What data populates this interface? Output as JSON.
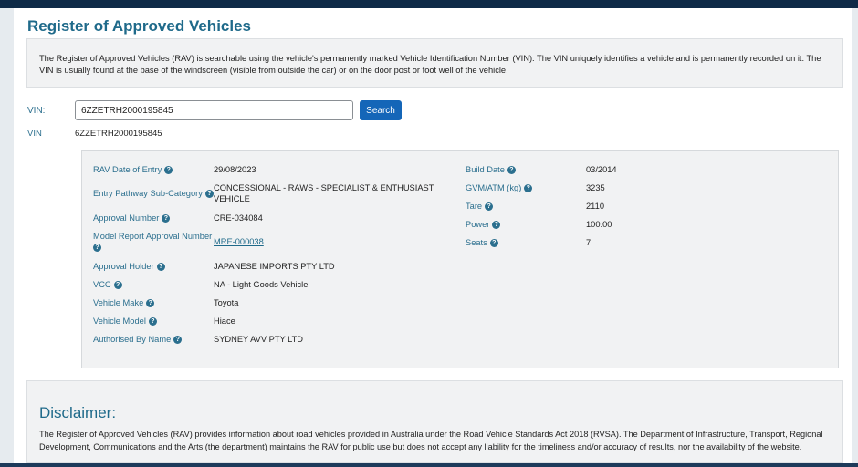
{
  "page": {
    "title": "Register of Approved Vehicles",
    "intro": "The Register of Approved Vehicles (RAV) is searchable using the vehicle's permanently marked Vehicle Identification Number (VIN). The VIN uniquely identifies a vehicle and is permanently recorded on it. The VIN is usually found at the base of the windscreen (visible from outside the car) or on the door post or foot well of the vehicle."
  },
  "search": {
    "label": "VIN:",
    "value": "6ZZETRH2000195845",
    "button_label": "Search"
  },
  "result": {
    "vin_label": "VIN",
    "vin_value": "6ZZETRH2000195845"
  },
  "details": {
    "left": [
      {
        "label": "RAV Date of Entry",
        "value": "29/08/2023"
      },
      {
        "label": "Entry Pathway Sub-Category",
        "value": "CONCESSIONAL - RAWS - SPECIALIST & ENTHUSIAST VEHICLE"
      },
      {
        "label": "Approval Number",
        "value": "CRE-034084"
      },
      {
        "label": "Model Report Approval Number",
        "value": "MRE-000038"
      },
      {
        "label": "Approval Holder",
        "value": "JAPANESE IMPORTS PTY LTD"
      },
      {
        "label": "VCC",
        "value": "NA - Light Goods Vehicle"
      },
      {
        "label": "Vehicle Make",
        "value": "Toyota"
      },
      {
        "label": "Vehicle Model",
        "value": "Hiace"
      },
      {
        "label": "Authorised By Name",
        "value": "SYDNEY AVV PTY LTD"
      }
    ],
    "right": [
      {
        "label": "Build Date",
        "value": "03/2014"
      },
      {
        "label": "GVM/ATM (kg)",
        "value": "3235"
      },
      {
        "label": "Tare",
        "value": "2110"
      },
      {
        "label": "Power",
        "value": "100.00"
      },
      {
        "label": "Seats",
        "value": "7"
      }
    ],
    "help_glyph": "?"
  },
  "disclaimer": {
    "title": "Disclaimer:",
    "text": "The Register of Approved Vehicles (RAV) provides information about road vehicles provided in Australia under the Road Vehicle Standards Act 2018 (RVSA). The Department of Infrastructure, Transport, Regional Development, Communications and the Arts (the department) maintains the RAV for public use but does not accept any liability for the timeliness and/or accuracy of results, nor the availability of the website."
  },
  "colors": {
    "accent": "#1f6a8a",
    "button": "#1466b8",
    "header_bar": "#0e2a47"
  }
}
